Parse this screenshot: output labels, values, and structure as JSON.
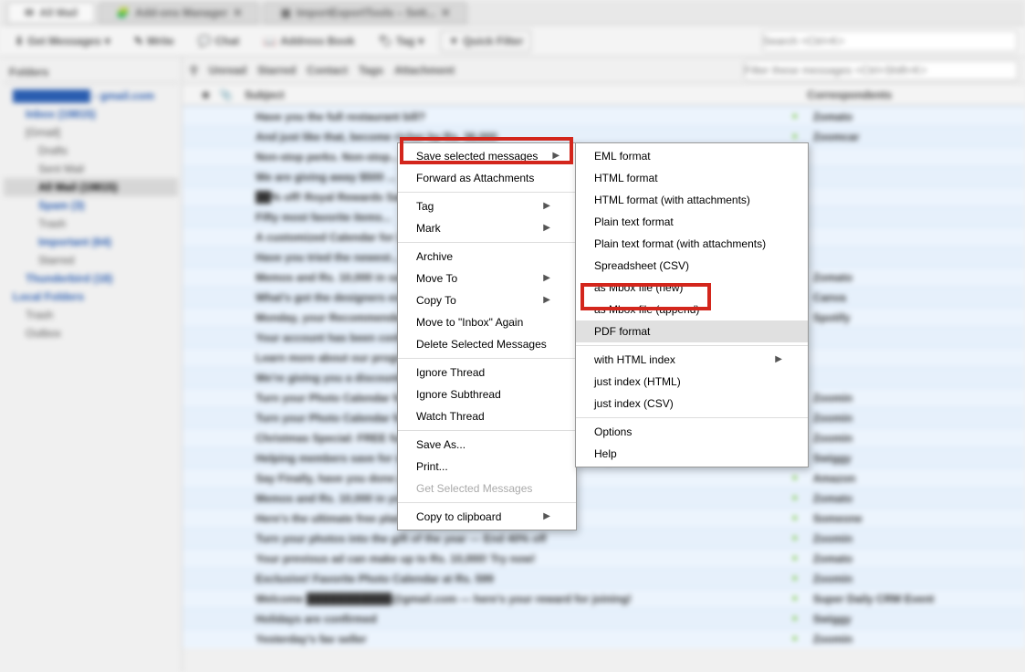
{
  "tabs": {
    "active": "All Mail",
    "others": [
      "Add-ons Manager",
      "ImportExportTools – Sett..."
    ]
  },
  "toolbar": {
    "get_messages": "Get Messages",
    "write": "Write",
    "chat": "Chat",
    "address_book": "Address Book",
    "tag": "Tag",
    "quick_filter": "Quick Filter",
    "search_placeholder": "Search <Ctrl+K>"
  },
  "sidebar": {
    "title": "Folders",
    "items": [
      {
        "label": "██████████ - gmail.com",
        "lvl": 1,
        "bold": true
      },
      {
        "label": "Inbox (19815)",
        "lvl": 2,
        "bold": true
      },
      {
        "label": "[Gmail]",
        "lvl": 2
      },
      {
        "label": "Drafts",
        "lvl": 3
      },
      {
        "label": "Sent Mail",
        "lvl": 3
      },
      {
        "label": "All Mail (19815)",
        "lvl": 3,
        "selected": true,
        "bold": true
      },
      {
        "label": "Spam (3)",
        "lvl": 3,
        "bold": true
      },
      {
        "label": "Trash",
        "lvl": 3
      },
      {
        "label": "Important (64)",
        "lvl": 3,
        "bold": true
      },
      {
        "label": "Starred",
        "lvl": 3
      },
      {
        "label": "Thunderbird (18)",
        "lvl": 2,
        "bold": true
      },
      {
        "label": "Local Folders",
        "lvl": 1,
        "bold": true
      },
      {
        "label": "Trash",
        "lvl": 2
      },
      {
        "label": "Outbox",
        "lvl": 2
      }
    ]
  },
  "filterbar": {
    "labels": [
      "Unread",
      "Starred",
      "Contact",
      "Tags",
      "Attachment"
    ],
    "search_placeholder": "Filter these messages <Ctrl+Shift+K>"
  },
  "columns": {
    "subject": "Subject",
    "corr": "Correspondents"
  },
  "rows": [
    {
      "subject": "Have you the full restaurant bill?",
      "dot": true,
      "corr": "Zomato"
    },
    {
      "subject": "And just like that, become richer by Rs. 36,000",
      "dot": true,
      "corr": "Zoomcar"
    },
    {
      "subject": "Non-stop perks. Non-stop...",
      "corr": ""
    },
    {
      "subject": "We are giving away $500 ...",
      "corr": ""
    },
    {
      "subject": "██% off! Royal Rewards Sale!",
      "corr": ""
    },
    {
      "subject": "Fifty most favorite items...",
      "corr": ""
    },
    {
      "subject": "A customized Calendar for 2020",
      "corr": ""
    },
    {
      "subject": "Have you tried the newest...",
      "corr": ""
    },
    {
      "subject": "Memos and Rs. 10,000 in savings!",
      "dot": true,
      "corr": "Zomato"
    },
    {
      "subject": "What's got the designers excited",
      "dot": true,
      "corr": "Canva"
    },
    {
      "subject": "Monday, your Recommended Mix is ready",
      "dot": true,
      "corr": "Spotify"
    },
    {
      "subject": "Your account has been confirmed",
      "corr": ""
    },
    {
      "subject": "Learn more about our programs",
      "corr": ""
    },
    {
      "subject": "We're giving you a discount!",
      "corr": ""
    },
    {
      "subject": "Turn your Photo Calendar for 2020",
      "dot": true,
      "corr": "Zoomin"
    },
    {
      "subject": "Turn your Photo Calendar for 2020",
      "dot": true,
      "corr": "Zoomin"
    },
    {
      "subject": "Christmas Special: FREE full-frame",
      "dot": true,
      "corr": "Zoomin"
    },
    {
      "subject": "Helping members save for seven! And another day for designs like 🖊",
      "dot": true,
      "corr": "Swiggy"
    },
    {
      "subject": "Say Finally, have you done good this year?",
      "dot": true,
      "corr": "Amazon"
    },
    {
      "subject": "Memos and Rs. 10,000 in your Inventory!",
      "dot": true,
      "corr": "Zomato"
    },
    {
      "subject": "Here's the ultimate free planning checklist",
      "dot": true,
      "corr": "Someone"
    },
    {
      "subject": "Turn your photos into the gift of the year — End 40% off",
      "dot": true,
      "corr": "Zoomin"
    },
    {
      "subject": "Your previous ad can make up to Rs. 10,000! Try now!",
      "dot": true,
      "corr": "Zomato"
    },
    {
      "subject": "Exclusive! Favorite Photo Calendar at Rs. 599",
      "dot": true,
      "corr": "Zoomin"
    },
    {
      "subject": "Welcome ███████████@gmail.com — here's your reward for joining!",
      "dot": true,
      "corr": "Super Daily CRM Event"
    },
    {
      "subject": "Holidays are confirmed",
      "dot": true,
      "corr": "Swiggy"
    },
    {
      "subject": "Yesterday's fav seller",
      "dot": true,
      "corr": "Zoomin"
    }
  ],
  "menu1": {
    "items": [
      {
        "id": "save-selected",
        "label": "Save selected messages",
        "arrow": true,
        "highlight": true
      },
      {
        "id": "forward-attach",
        "label": "Forward as Attachments"
      },
      {
        "id": "sep"
      },
      {
        "id": "tag",
        "label": "Tag",
        "arrow": true
      },
      {
        "id": "mark",
        "label": "Mark",
        "arrow": true
      },
      {
        "id": "sep"
      },
      {
        "id": "archive",
        "label": "Archive"
      },
      {
        "id": "move-to",
        "label": "Move To",
        "arrow": true
      },
      {
        "id": "copy-to",
        "label": "Copy To",
        "arrow": true
      },
      {
        "id": "move-inbox",
        "label": "Move to \"Inbox\" Again"
      },
      {
        "id": "delete",
        "label": "Delete Selected Messages"
      },
      {
        "id": "sep"
      },
      {
        "id": "ignore-thread",
        "label": "Ignore Thread"
      },
      {
        "id": "ignore-sub",
        "label": "Ignore Subthread"
      },
      {
        "id": "watch-thread",
        "label": "Watch Thread"
      },
      {
        "id": "sep"
      },
      {
        "id": "save-as",
        "label": "Save As..."
      },
      {
        "id": "print",
        "label": "Print..."
      },
      {
        "id": "get-sel",
        "label": "Get Selected Messages",
        "disabled": true
      },
      {
        "id": "sep"
      },
      {
        "id": "copy-clip",
        "label": "Copy to clipboard",
        "arrow": true
      }
    ]
  },
  "menu2": {
    "items": [
      {
        "id": "eml",
        "label": "EML format"
      },
      {
        "id": "html",
        "label": "HTML format"
      },
      {
        "id": "html-att",
        "label": "HTML format (with attachments)"
      },
      {
        "id": "text",
        "label": "Plain text format"
      },
      {
        "id": "text-att",
        "label": "Plain text format (with attachments)"
      },
      {
        "id": "csv",
        "label": "Spreadsheet (CSV)"
      },
      {
        "id": "mbox-new",
        "label": "as Mbox file (new)"
      },
      {
        "id": "mbox-app",
        "label": "as Mbox file (append)"
      },
      {
        "id": "pdf",
        "label": "PDF format",
        "hovered": true,
        "highlight": true
      },
      {
        "id": "sep"
      },
      {
        "id": "html-index",
        "label": "with HTML index",
        "arrow": true
      },
      {
        "id": "idx-html",
        "label": "just index (HTML)"
      },
      {
        "id": "idx-csv",
        "label": "just index (CSV)"
      },
      {
        "id": "sep"
      },
      {
        "id": "options",
        "label": "Options"
      },
      {
        "id": "help",
        "label": "Help"
      }
    ]
  }
}
